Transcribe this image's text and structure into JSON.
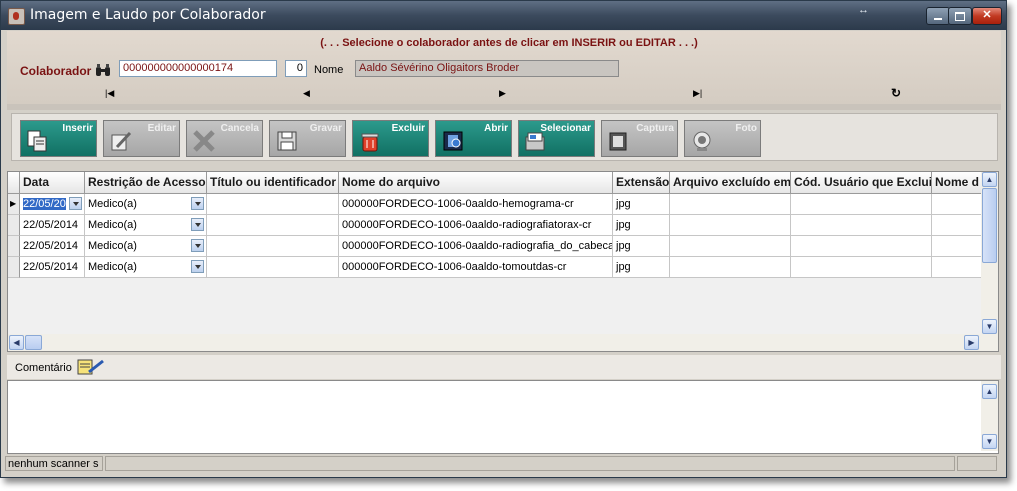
{
  "window": {
    "title": "Imagem e Laudo por Colaborador"
  },
  "form": {
    "hint": "(. . .  Selecione o colaborador antes de clicar em INSERIR ou EDITAR . . .)",
    "colaborador_label": "Colaborador",
    "codigo": "000000000000000174",
    "numero": "0",
    "nome_label": "Nome",
    "nome": "Aaldo Sévérino Oligaitors Broder"
  },
  "toolbar": {
    "inserir": "Inserir",
    "editar": "Editar",
    "cancela": "Cancela",
    "gravar": "Gravar",
    "excluir": "Excluir",
    "abrir": "Abrir",
    "selecionar": "Selecionar",
    "captura": "Captura",
    "foto": "Foto"
  },
  "grid": {
    "headers": [
      "Data",
      "Restrição de Acesso",
      "Título ou identificador",
      "Nome do arquivo",
      "Extensão",
      "Arquivo excluído em",
      "Cód. Usuário que Exclui",
      "Nome d"
    ],
    "rows": [
      {
        "data": "22/05/20",
        "restricao": "Medico(a)",
        "titulo": "",
        "arquivo": "000000FORDECO-1006-0aaldo-hemograma-cr",
        "ext": "jpg"
      },
      {
        "data": "22/05/2014",
        "restricao": "Medico(a)",
        "titulo": "",
        "arquivo": "000000FORDECO-1006-0aaldo-radiografiatorax-cr",
        "ext": "jpg"
      },
      {
        "data": "22/05/2014",
        "restricao": "Medico(a)",
        "titulo": "",
        "arquivo": "000000FORDECO-1006-0aaldo-radiografia_do_cabecao-",
        "ext": "jpg"
      },
      {
        "data": "22/05/2014",
        "restricao": "Medico(a)",
        "titulo": "",
        "arquivo": "000000FORDECO-1006-0aaldo-tomoutdas-cr",
        "ext": "jpg"
      }
    ]
  },
  "comentario": {
    "label": "Comentário"
  },
  "status": {
    "text": "nenhum scanner s"
  }
}
